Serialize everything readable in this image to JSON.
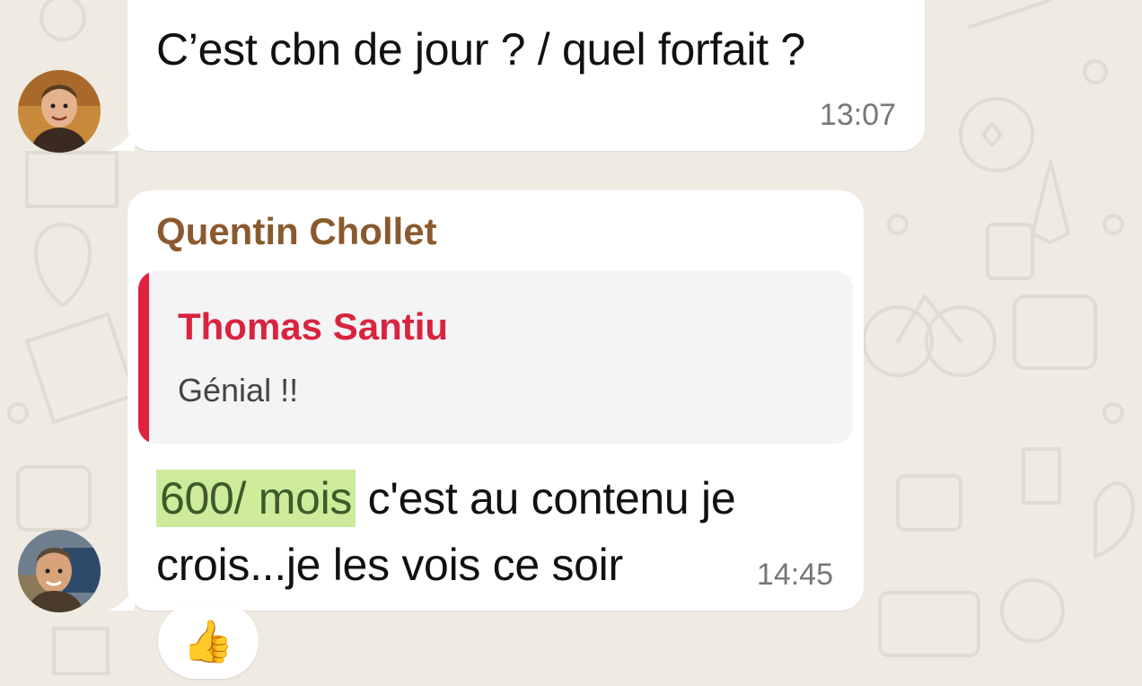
{
  "messages": [
    {
      "text": "C’est cbn de jour ? / quel forfait ?",
      "time": "13:07"
    },
    {
      "sender": "Quentin Chollet",
      "quote": {
        "author": "Thomas Santiu",
        "text": "Génial !!"
      },
      "highlight": "600/ mois",
      "text_rest": " c'est au contenu je crois...je les vois ce soir",
      "time": "14:45",
      "reaction": "👍"
    }
  ],
  "colors": {
    "background": "#efeae2",
    "bubble": "#ffffff",
    "sender_name": "#8a5a2e",
    "quote_author": "#d8243f",
    "quote_bar": "#e0213f",
    "highlight": "#cdeb9b"
  }
}
